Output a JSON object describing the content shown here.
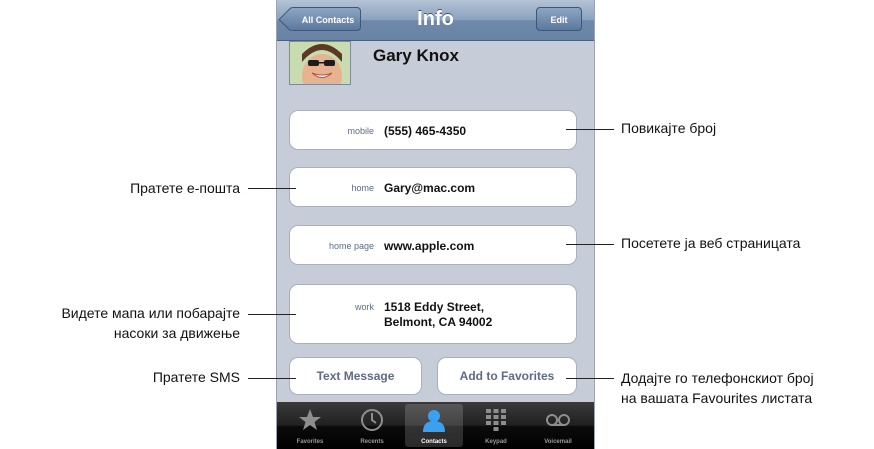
{
  "navbar": {
    "back_label": "All Contacts",
    "title": "Info",
    "edit_label": "Edit"
  },
  "contact": {
    "name": "Gary Knox"
  },
  "fields": [
    {
      "label": "mobile",
      "value": "(555) 465-4350"
    },
    {
      "label": "home",
      "value": "Gary@mac.com"
    },
    {
      "label": "home page",
      "value": "www.apple.com"
    },
    {
      "label": "work",
      "value_lines": [
        "1518 Eddy Street,",
        "Belmont, CA 94002"
      ]
    }
  ],
  "actions": {
    "text_message": "Text Message",
    "add_to_favorites": "Add to Favorites"
  },
  "tabs": [
    {
      "label": "Favorites",
      "icon": "star-icon"
    },
    {
      "label": "Recents",
      "icon": "clock-icon"
    },
    {
      "label": "Contacts",
      "icon": "person-icon",
      "active": true
    },
    {
      "label": "Keypad",
      "icon": "keypad-icon"
    },
    {
      "label": "Voicemail",
      "icon": "voicemail-icon"
    }
  ],
  "callouts": {
    "call": "Повикајте број",
    "email": "Пратете е-пошта",
    "webpage": "Посетете ја веб страницата",
    "map_line1": "Видете мапа или побарајте",
    "map_line2": "насоки за движење",
    "sms": "Пратете SMS",
    "fav_line1": "Додајте го телефонскиот број",
    "fav_line2": "на вашата Favourites листата"
  },
  "colors": {
    "navbar": "#6e89aa",
    "screen_bg": "#c7cdd8",
    "label_blue": "#5d6b86",
    "tabbar": "#000000"
  }
}
